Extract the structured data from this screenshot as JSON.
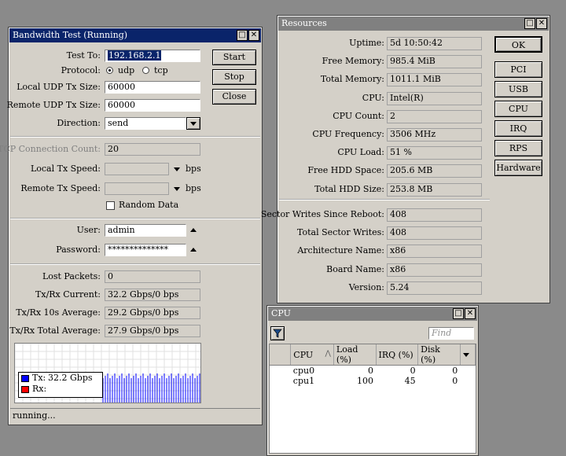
{
  "bwtest": {
    "title": "Bandwidth Test (Running)",
    "test_to_label": "Test To:",
    "test_to_value": "192.168.2.1",
    "protocol_label": "Protocol:",
    "protocol_udp": "udp",
    "protocol_tcp": "tcp",
    "local_udp_label": "Local UDP Tx Size:",
    "local_udp_value": "60000",
    "remote_udp_label": "Remote UDP Tx Size:",
    "remote_udp_value": "60000",
    "direction_label": "Direction:",
    "direction_value": "send",
    "tcp_conn_label": "TCP Connection Count:",
    "tcp_conn_value": "20",
    "local_tx_label": "Local Tx Speed:",
    "remote_tx_label": "Remote Tx Speed:",
    "bps_unit": "bps",
    "random_data_label": "Random Data",
    "user_label": "User:",
    "user_value": "admin",
    "password_label": "Password:",
    "password_value": "**************",
    "lost_packets_label": "Lost Packets:",
    "lost_packets_value": "0",
    "current_label": "Tx/Rx Current:",
    "current_value": "32.2 Gbps/0 bps",
    "avg10_label": "Tx/Rx 10s Average:",
    "avg10_value": "29.2 Gbps/0 bps",
    "total_avg_label": "Tx/Rx Total Average:",
    "total_avg_value": "27.9 Gbps/0 bps",
    "legend_tx_label": "Tx:",
    "legend_tx_value": "32.2 Gbps",
    "legend_rx_label": "Rx:",
    "status": "running...",
    "start_button": "Start",
    "stop_button": "Stop",
    "close_button": "Close",
    "tx_color": "#0000ff",
    "rx_color": "#ff0000"
  },
  "resources": {
    "title": "Resources",
    "rows": [
      {
        "label": "Uptime:",
        "value": "5d 10:50:42"
      },
      {
        "label": "Free Memory:",
        "value": "985.4 MiB"
      },
      {
        "label": "Total Memory:",
        "value": "1011.1 MiB"
      },
      {
        "label": "CPU:",
        "value": "Intel(R)"
      },
      {
        "label": "CPU Count:",
        "value": "2"
      },
      {
        "label": "CPU Frequency:",
        "value": "3506 MHz"
      },
      {
        "label": "CPU Load:",
        "value": "51 %"
      },
      {
        "label": "Free HDD Space:",
        "value": "205.6 MB"
      },
      {
        "label": "Total HDD Size:",
        "value": "253.8 MB"
      }
    ],
    "rows2": [
      {
        "label": "Sector Writes Since Reboot:",
        "value": "408"
      },
      {
        "label": "Total Sector Writes:",
        "value": "408"
      },
      {
        "label": "Architecture Name:",
        "value": "x86"
      },
      {
        "label": "Board Name:",
        "value": "x86"
      },
      {
        "label": "Version:",
        "value": "5.24"
      }
    ],
    "buttons": [
      "OK",
      "PCI",
      "USB",
      "CPU",
      "IRQ",
      "RPS",
      "Hardware"
    ]
  },
  "cpu": {
    "title": "CPU",
    "find_placeholder": "Find",
    "columns": [
      "CPU",
      "Load (%)",
      "IRQ (%)",
      "Disk (%)"
    ],
    "rows": [
      {
        "cpu": "cpu0",
        "load": "0",
        "irq": "0",
        "disk": "0"
      },
      {
        "cpu": "cpu1",
        "load": "100",
        "irq": "45",
        "disk": "0"
      }
    ]
  }
}
